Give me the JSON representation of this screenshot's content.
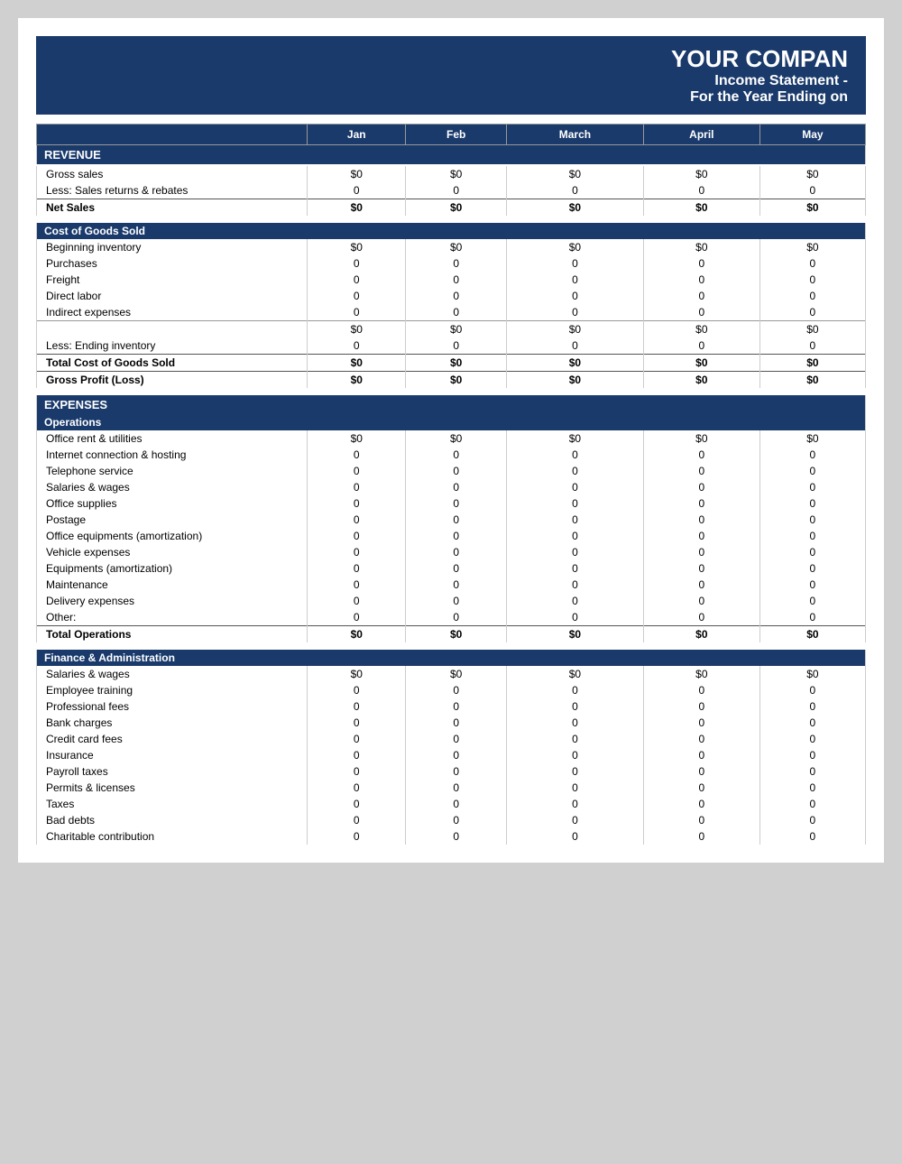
{
  "header": {
    "company": "YOUR COMPAN",
    "subtitle": "Income Statement -",
    "period": "For the Year Ending on"
  },
  "columns": [
    "Jan",
    "Feb",
    "March",
    "April",
    "May"
  ],
  "sections": {
    "revenue": {
      "label": "REVENUE",
      "rows": [
        {
          "label": "Gross sales",
          "values": [
            "$0",
            "$0",
            "$0",
            "$0",
            "$0"
          ]
        },
        {
          "label": "Less: Sales returns & rebates",
          "values": [
            "0",
            "0",
            "0",
            "0",
            "0"
          ]
        }
      ],
      "total": {
        "label": "Net Sales",
        "values": [
          "$0",
          "$0",
          "$0",
          "$0",
          "$0"
        ]
      }
    },
    "cogs": {
      "label": "Cost of Goods Sold",
      "rows": [
        {
          "label": "Beginning inventory",
          "values": [
            "$0",
            "$0",
            "$0",
            "$0",
            "$0"
          ]
        },
        {
          "label": "Purchases",
          "values": [
            "0",
            "0",
            "0",
            "0",
            "0"
          ]
        },
        {
          "label": "Freight",
          "values": [
            "0",
            "0",
            "0",
            "0",
            "0"
          ]
        },
        {
          "label": "Direct labor",
          "values": [
            "0",
            "0",
            "0",
            "0",
            "0"
          ]
        },
        {
          "label": "Indirect expenses",
          "values": [
            "0",
            "0",
            "0",
            "0",
            "0"
          ]
        }
      ],
      "subtotal": {
        "label": "",
        "values": [
          "$0",
          "$0",
          "$0",
          "$0",
          "$0"
        ]
      },
      "less_row": {
        "label": "Less: Ending inventory",
        "values": [
          "0",
          "0",
          "0",
          "0",
          "0"
        ]
      },
      "total": {
        "label": "Total Cost of Goods Sold",
        "values": [
          "$0",
          "$0",
          "$0",
          "$0",
          "$0"
        ]
      },
      "gross_profit": {
        "label": "Gross Profit (Loss)",
        "values": [
          "$0",
          "$0",
          "$0",
          "$0",
          "$0"
        ]
      }
    },
    "expenses": {
      "label": "EXPENSES",
      "operations": {
        "label": "Operations",
        "rows": [
          {
            "label": "Office rent & utilities",
            "values": [
              "$0",
              "$0",
              "$0",
              "$0",
              "$0"
            ]
          },
          {
            "label": "Internet connection & hosting",
            "values": [
              "0",
              "0",
              "0",
              "0",
              "0"
            ]
          },
          {
            "label": "Telephone service",
            "values": [
              "0",
              "0",
              "0",
              "0",
              "0"
            ]
          },
          {
            "label": "Salaries & wages",
            "values": [
              "0",
              "0",
              "0",
              "0",
              "0"
            ]
          },
          {
            "label": "Office supplies",
            "values": [
              "0",
              "0",
              "0",
              "0",
              "0"
            ]
          },
          {
            "label": "Postage",
            "values": [
              "0",
              "0",
              "0",
              "0",
              "0"
            ]
          },
          {
            "label": "Office equipments (amortization)",
            "values": [
              "0",
              "0",
              "0",
              "0",
              "0"
            ]
          },
          {
            "label": "Vehicle expenses",
            "values": [
              "0",
              "0",
              "0",
              "0",
              "0"
            ]
          },
          {
            "label": "Equipments (amortization)",
            "values": [
              "0",
              "0",
              "0",
              "0",
              "0"
            ]
          },
          {
            "label": "Maintenance",
            "values": [
              "0",
              "0",
              "0",
              "0",
              "0"
            ]
          },
          {
            "label": "Delivery expenses",
            "values": [
              "0",
              "0",
              "0",
              "0",
              "0"
            ]
          },
          {
            "label": "Other:",
            "values": [
              "0",
              "0",
              "0",
              "0",
              "0"
            ]
          }
        ],
        "total": {
          "label": "Total Operations",
          "values": [
            "$0",
            "$0",
            "$0",
            "$0",
            "$0"
          ]
        }
      },
      "finance_admin": {
        "label": "Finance & Administration",
        "rows": [
          {
            "label": "Salaries & wages",
            "values": [
              "$0",
              "$0",
              "$0",
              "$0",
              "$0"
            ]
          },
          {
            "label": "Employee training",
            "values": [
              "0",
              "0",
              "0",
              "0",
              "0"
            ]
          },
          {
            "label": "Professional fees",
            "values": [
              "0",
              "0",
              "0",
              "0",
              "0"
            ]
          },
          {
            "label": "Bank charges",
            "values": [
              "0",
              "0",
              "0",
              "0",
              "0"
            ]
          },
          {
            "label": "Credit card fees",
            "values": [
              "0",
              "0",
              "0",
              "0",
              "0"
            ]
          },
          {
            "label": "Insurance",
            "values": [
              "0",
              "0",
              "0",
              "0",
              "0"
            ]
          },
          {
            "label": "Payroll taxes",
            "values": [
              "0",
              "0",
              "0",
              "0",
              "0"
            ]
          },
          {
            "label": "Permits & licenses",
            "values": [
              "0",
              "0",
              "0",
              "0",
              "0"
            ]
          },
          {
            "label": "Taxes",
            "values": [
              "0",
              "0",
              "0",
              "0",
              "0"
            ]
          },
          {
            "label": "Bad debts",
            "values": [
              "0",
              "0",
              "0",
              "0",
              "0"
            ]
          },
          {
            "label": "Charitable contribution",
            "values": [
              "0",
              "0",
              "0",
              "0",
              "0"
            ]
          }
        ]
      }
    }
  }
}
